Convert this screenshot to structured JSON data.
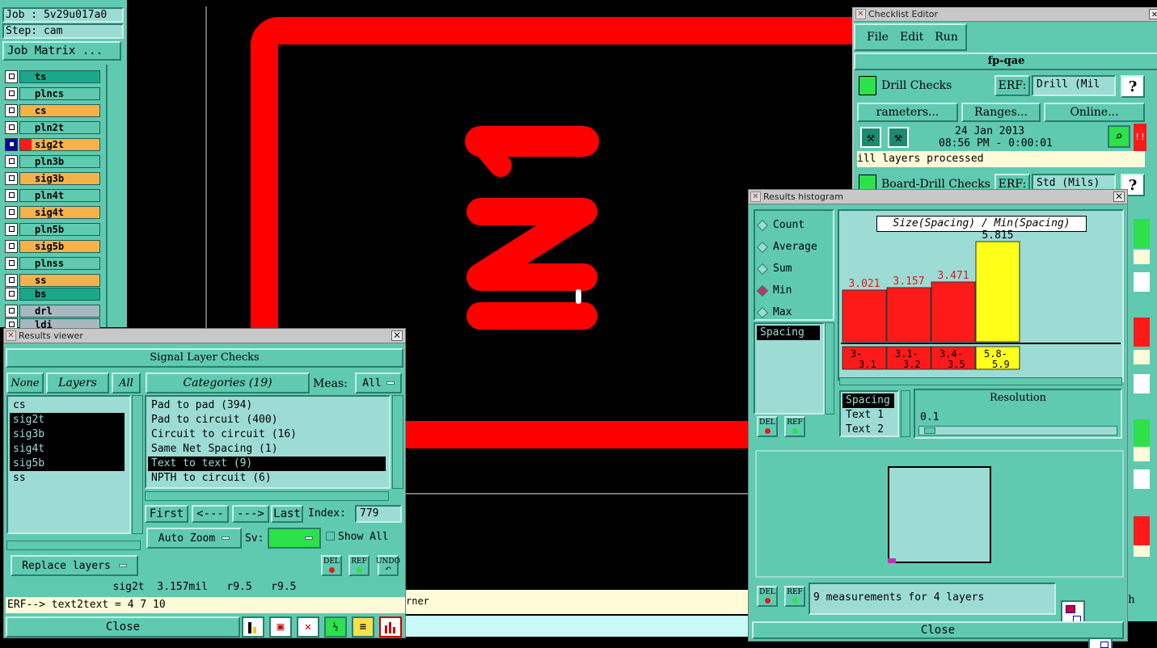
{
  "job_panel": {
    "job": "Job : 5v29u017a0",
    "step": "Step: cam",
    "matrix_button": "Job Matrix ...",
    "layers": [
      {
        "name": "ts",
        "color": "#1aa88a"
      },
      {
        "name": "plncs",
        "color": "#5fcab0"
      },
      {
        "name": "cs",
        "color": "#f5b24a"
      },
      {
        "name": "pln2t",
        "color": "#5fcab0"
      },
      {
        "name": "sig2t",
        "color": "#f5b24a"
      },
      {
        "name": "pln3b",
        "color": "#5fcab0"
      },
      {
        "name": "sig3b",
        "color": "#f5b24a"
      },
      {
        "name": "pln4t",
        "color": "#5fcab0"
      },
      {
        "name": "sig4t",
        "color": "#f5b24a"
      },
      {
        "name": "pln5b",
        "color": "#5fcab0"
      },
      {
        "name": "sig5b",
        "color": "#f5b24a"
      },
      {
        "name": "plnss",
        "color": "#5fcab0"
      },
      {
        "name": "ss",
        "color": "#f5b24a"
      },
      {
        "name": "bs",
        "color": "#1aa88a"
      },
      {
        "name": "drl",
        "color": "#a8b8c0"
      },
      {
        "name": "ldi",
        "color": "#a8b8c0"
      }
    ]
  },
  "canvas": {
    "trace_color": "#ff0000",
    "bottom_text": "rner"
  },
  "results_viewer": {
    "title": "Results viewer",
    "header": "Signal Layer Checks",
    "none_btn": "None",
    "layers_label": "Layers",
    "all_btn": "All",
    "categories_label": "Categories (19)",
    "meas_label": "Meas:",
    "meas_value": "All",
    "layer_list": [
      "cs",
      "sig2t",
      "sig3b",
      "sig4t",
      "sig5b",
      "ss"
    ],
    "selected_layers": [
      "sig2t",
      "sig3b",
      "sig4t",
      "sig5b"
    ],
    "categories": [
      "Pad to pad (394)",
      "Pad to circuit (400)",
      "Circuit to circuit (16)",
      "Same Net Spacing (1)",
      "Text to text (9)",
      "NPTH to circuit (6)"
    ],
    "selected_category": "Text to text (9)",
    "first": "First",
    "prev": "<---",
    "next": "--->",
    "last": "Last",
    "index_label": "Index:",
    "index_value": "779",
    "auto_zoom": "Auto Zoom",
    "sv_label": "Sv:",
    "show_all": "Show All",
    "replace_layers": "Replace layers",
    "del": "DEL",
    "ref": "REF",
    "undo": "UNDO",
    "status_line": "sig2t  3.157mil   r9.5   r9.5",
    "erf_line": "ERF--> text2text = 4 7 10",
    "close": "Close"
  },
  "checklist_editor": {
    "title": "Checklist Editor",
    "menu": [
      "File",
      "Edit",
      "Run"
    ],
    "name": "fp-qae",
    "check1": {
      "label": "Drill Checks",
      "erf_label": "ERF:",
      "erf_value": "Drill (Mil",
      "help": "?"
    },
    "buttons": [
      "rameters...",
      "Ranges...",
      "Online..."
    ],
    "date": "24 Jan 2013",
    "time": "08:56 PM - 0:00:01",
    "status": "ill layers processed",
    "check2": {
      "label": "Board-Drill Checks",
      "erf_label": "ERF:",
      "erf_value": "Std (Mils)",
      "help": "?"
    },
    "alert": "!!"
  },
  "histogram": {
    "title": "Results histogram",
    "modes": [
      "Count",
      "Average",
      "Sum",
      "Min",
      "Max"
    ],
    "selected_mode": "Min",
    "measure_list": [
      "Spacing"
    ],
    "chart_title": "Size(Spacing) / Min(Spacing)",
    "text_list": [
      "Spacing",
      "Text 1",
      "Text 2"
    ],
    "resolution_label": "Resolution",
    "resolution_value": "0.1",
    "summary": "9 measurements for 4 layers",
    "close": "Close"
  },
  "chart_data": {
    "type": "bar",
    "title": "Size(Spacing) / Min(Spacing)",
    "categories": [
      "3-3.1",
      "3.1-3.2",
      "3.4-3.5",
      "5.8-5.9"
    ],
    "category_labels": [
      [
        "3-",
        "3.1"
      ],
      [
        "3.1-",
        "3.2"
      ],
      [
        "3.4-",
        "3.5"
      ],
      [
        "5.8-",
        "5.9"
      ]
    ],
    "values": [
      3.021,
      3.157,
      3.471,
      5.815
    ],
    "value_labels": [
      "3.021",
      "3.157",
      "3.471",
      "5.815"
    ],
    "colors": [
      "#ff1a1a",
      "#ff1a1a",
      "#ff1a1a",
      "#ffff1a"
    ]
  },
  "right_edge": {
    "partial_text": "th"
  }
}
